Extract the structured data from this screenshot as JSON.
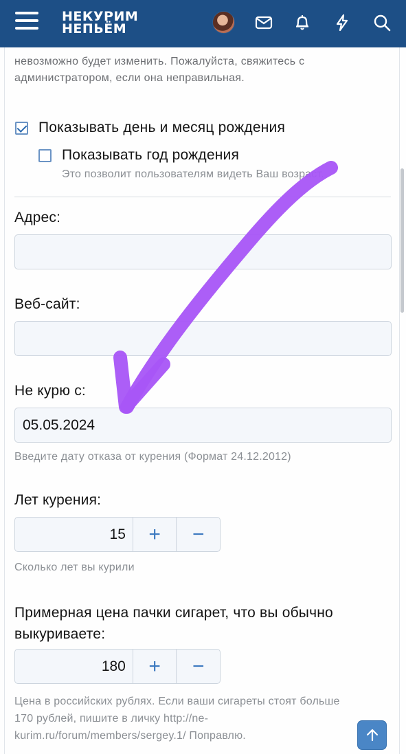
{
  "header": {
    "logo_line1": "НЕКУРИМ",
    "logo_line2": "НЕПЬЁМ",
    "icons": [
      "menu-icon",
      "avatar",
      "mail-icon",
      "bell-icon",
      "lightning-icon",
      "search-icon"
    ]
  },
  "dob_note": {
    "line1": "невозможно будет изменить. Пожалуйста, свяжитесь с",
    "line2": "администратором, если она неправильная."
  },
  "show_day_month": {
    "label": "Показывать день и месяц рождения",
    "checked": true
  },
  "show_year": {
    "label": "Показывать год рождения",
    "checked": false,
    "hint": "Это позволит пользователям видеть Ваш возраст."
  },
  "address": {
    "label": "Адрес:",
    "value": ""
  },
  "website": {
    "label": "Веб-сайт:",
    "value": ""
  },
  "quit_date": {
    "label": "Не курю с:",
    "value": "05.05.2024",
    "hint": "Введите дату отказа от курения (Формат 24.12.2012)"
  },
  "years_smoking": {
    "label": "Лет курения:",
    "value": "15",
    "plus": "+",
    "minus": "−",
    "hint": "Сколько лет вы курили"
  },
  "pack_price": {
    "label_line1": "Примерная цена пачки сигарет, что вы обычно",
    "label_line2": "выкуриваете:",
    "value": "180",
    "plus": "+",
    "minus": "−",
    "hint_line1": "Цена в российских рублях. Если ваши сигареты стоят больше",
    "hint_line2": "170 рублей, пишите в личку http://ne-",
    "hint_line3": "kurim.ru/forum/members/sergey.1/ Поправлю."
  },
  "colors": {
    "header": "#1d4f86",
    "accent": "#3d7ac0",
    "annotation_arrow": "#a855f7"
  }
}
